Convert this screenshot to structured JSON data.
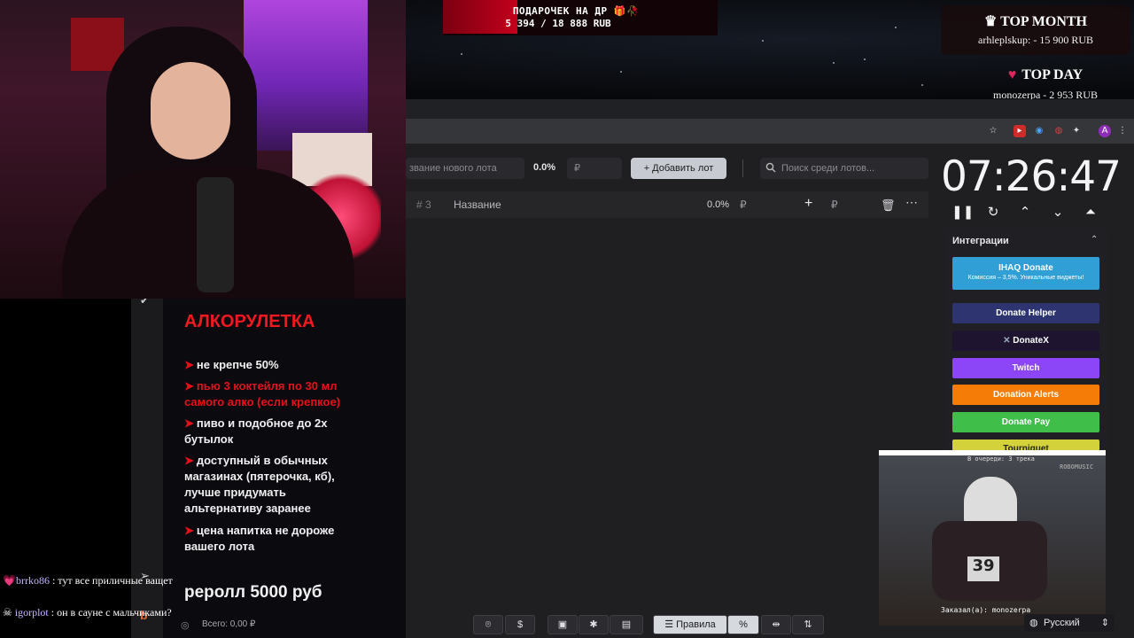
{
  "overlay": {
    "gift_title": "ПОДАРОЧЕК НА ДР 🎁🥀",
    "gift_amount": "5 394 / 18 888 RUB",
    "top_month_title": "TOP MONTH",
    "top_month_value": "arhlеplskup: - 15 900 RUB",
    "top_day_title": "TOP DAY",
    "top_day_value": "monozerpa - 2 953 RUB"
  },
  "toolbar": {
    "lot_placeholder": "звание нового лота",
    "percent": "0.0%",
    "rub_placeholder": "₽",
    "add_label": "Добавить лот",
    "search_placeholder": "Поиск среди лотов..."
  },
  "lot_row": {
    "number": "# 3",
    "name": "Название",
    "percent": "0.0%",
    "rub": "₽",
    "rub2": "₽"
  },
  "timer": {
    "time": "07:26:47"
  },
  "integrations": {
    "title": "Интеграции",
    "services": [
      {
        "label": "IHAQ Donate",
        "sub": "Комиссия – 3,5%. Уникальные виджеты!",
        "color": "#2f9fd6"
      },
      {
        "label": "Donate Helper",
        "color": "#2e3470"
      },
      {
        "label": "DonateX",
        "color": "#1e1430"
      },
      {
        "label": "Twitch",
        "color": "#8c45f7"
      },
      {
        "label": "Donation Alerts",
        "color": "#f57d07"
      },
      {
        "label": "Donate Pay",
        "color": "#3fbe4a"
      },
      {
        "label": "Tourniquet",
        "color": "#d3d23a"
      }
    ]
  },
  "rules": {
    "title": "АЛКОРУЛЕТКА",
    "items": [
      {
        "text": "не крепче 50%"
      },
      {
        "text": "пью 3 коктейля по 30 мл самого алко (если крепкое)"
      },
      {
        "text": "пиво и подобное до 2х бутылок"
      },
      {
        "text": "доступный в обычных магазинах (пятерочка, кб), лучше придумать альтернативу заранее"
      },
      {
        "text": "цена напитка не дороже вашего лота"
      }
    ],
    "reroll": "реролл 5000 руб",
    "total": "Всего: 0,00 ₽"
  },
  "bottom_bar": {
    "rules_label": "Правила",
    "percent_icon": "%",
    "dollar_icon": "$"
  },
  "chat": [
    {
      "user": "brrko86",
      "message": "тут все приличные ващет"
    },
    {
      "user": "igorplot",
      "message": "он в сауне с мальчиками?"
    }
  ],
  "music": {
    "queue": "В очереди: 3 трека",
    "brand": "ROBOMUSIC",
    "ordered": "Заказал(а): monozerpa"
  },
  "language": "Русский",
  "colors": {
    "accent_red": "#e4101a",
    "page_bg": "#1f1f22"
  }
}
